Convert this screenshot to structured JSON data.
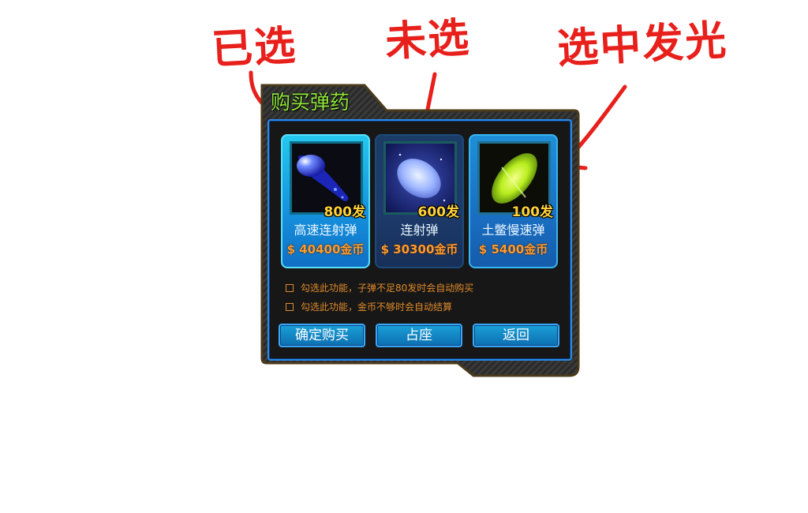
{
  "annotations": {
    "selected_label": "已选",
    "unselected_label": "未选",
    "highlight_label": "选中发光",
    "color": "#e8201c"
  },
  "dialog": {
    "title": "购买弹药",
    "items": [
      {
        "count": "800发",
        "name": "高速连射弹",
        "price": "$ 40400金币",
        "state": "selected",
        "icon": "blue-comet-bullet-icon"
      },
      {
        "count": "600发",
        "name": "连射弹",
        "price": "$ 30300金币",
        "state": "unselected",
        "icon": "white-oval-bullet-icon"
      },
      {
        "count": "100发",
        "name": "土鳖慢速弹",
        "price": "$ 5400金币",
        "state": "highlight",
        "icon": "green-glow-bullet-icon"
      }
    ],
    "options": [
      {
        "label": "勾选此功能，子弹不足80发时会自动购买",
        "checked": false
      },
      {
        "label": "勾选此功能，金币不够时会自动结算",
        "checked": false
      }
    ],
    "buttons": {
      "confirm": "确定购买",
      "occupy": "占座",
      "back": "返回"
    },
    "colors": {
      "title": "#8fe63a",
      "count": "#ffd23a",
      "price": "#ff9a2c",
      "option_text": "#e08a2a",
      "frame_blue": "#2a8be8"
    }
  }
}
